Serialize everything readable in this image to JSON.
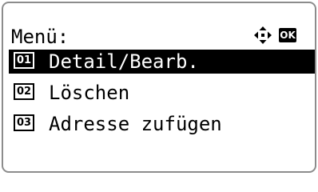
{
  "header": {
    "title": "Menü:",
    "nav_icon": "four-way-arrow-icon",
    "ok_label": "OK"
  },
  "menu": {
    "items": [
      {
        "number": "01",
        "label": "Detail/Bearb.",
        "selected": true
      },
      {
        "number": "02",
        "label": "Löschen",
        "selected": false
      },
      {
        "number": "03",
        "label": "Adresse zufügen",
        "selected": false
      }
    ]
  },
  "colors": {
    "background": "#ffffff",
    "text": "#000000",
    "selection": "#000000",
    "frame": "#8c8c8c"
  }
}
